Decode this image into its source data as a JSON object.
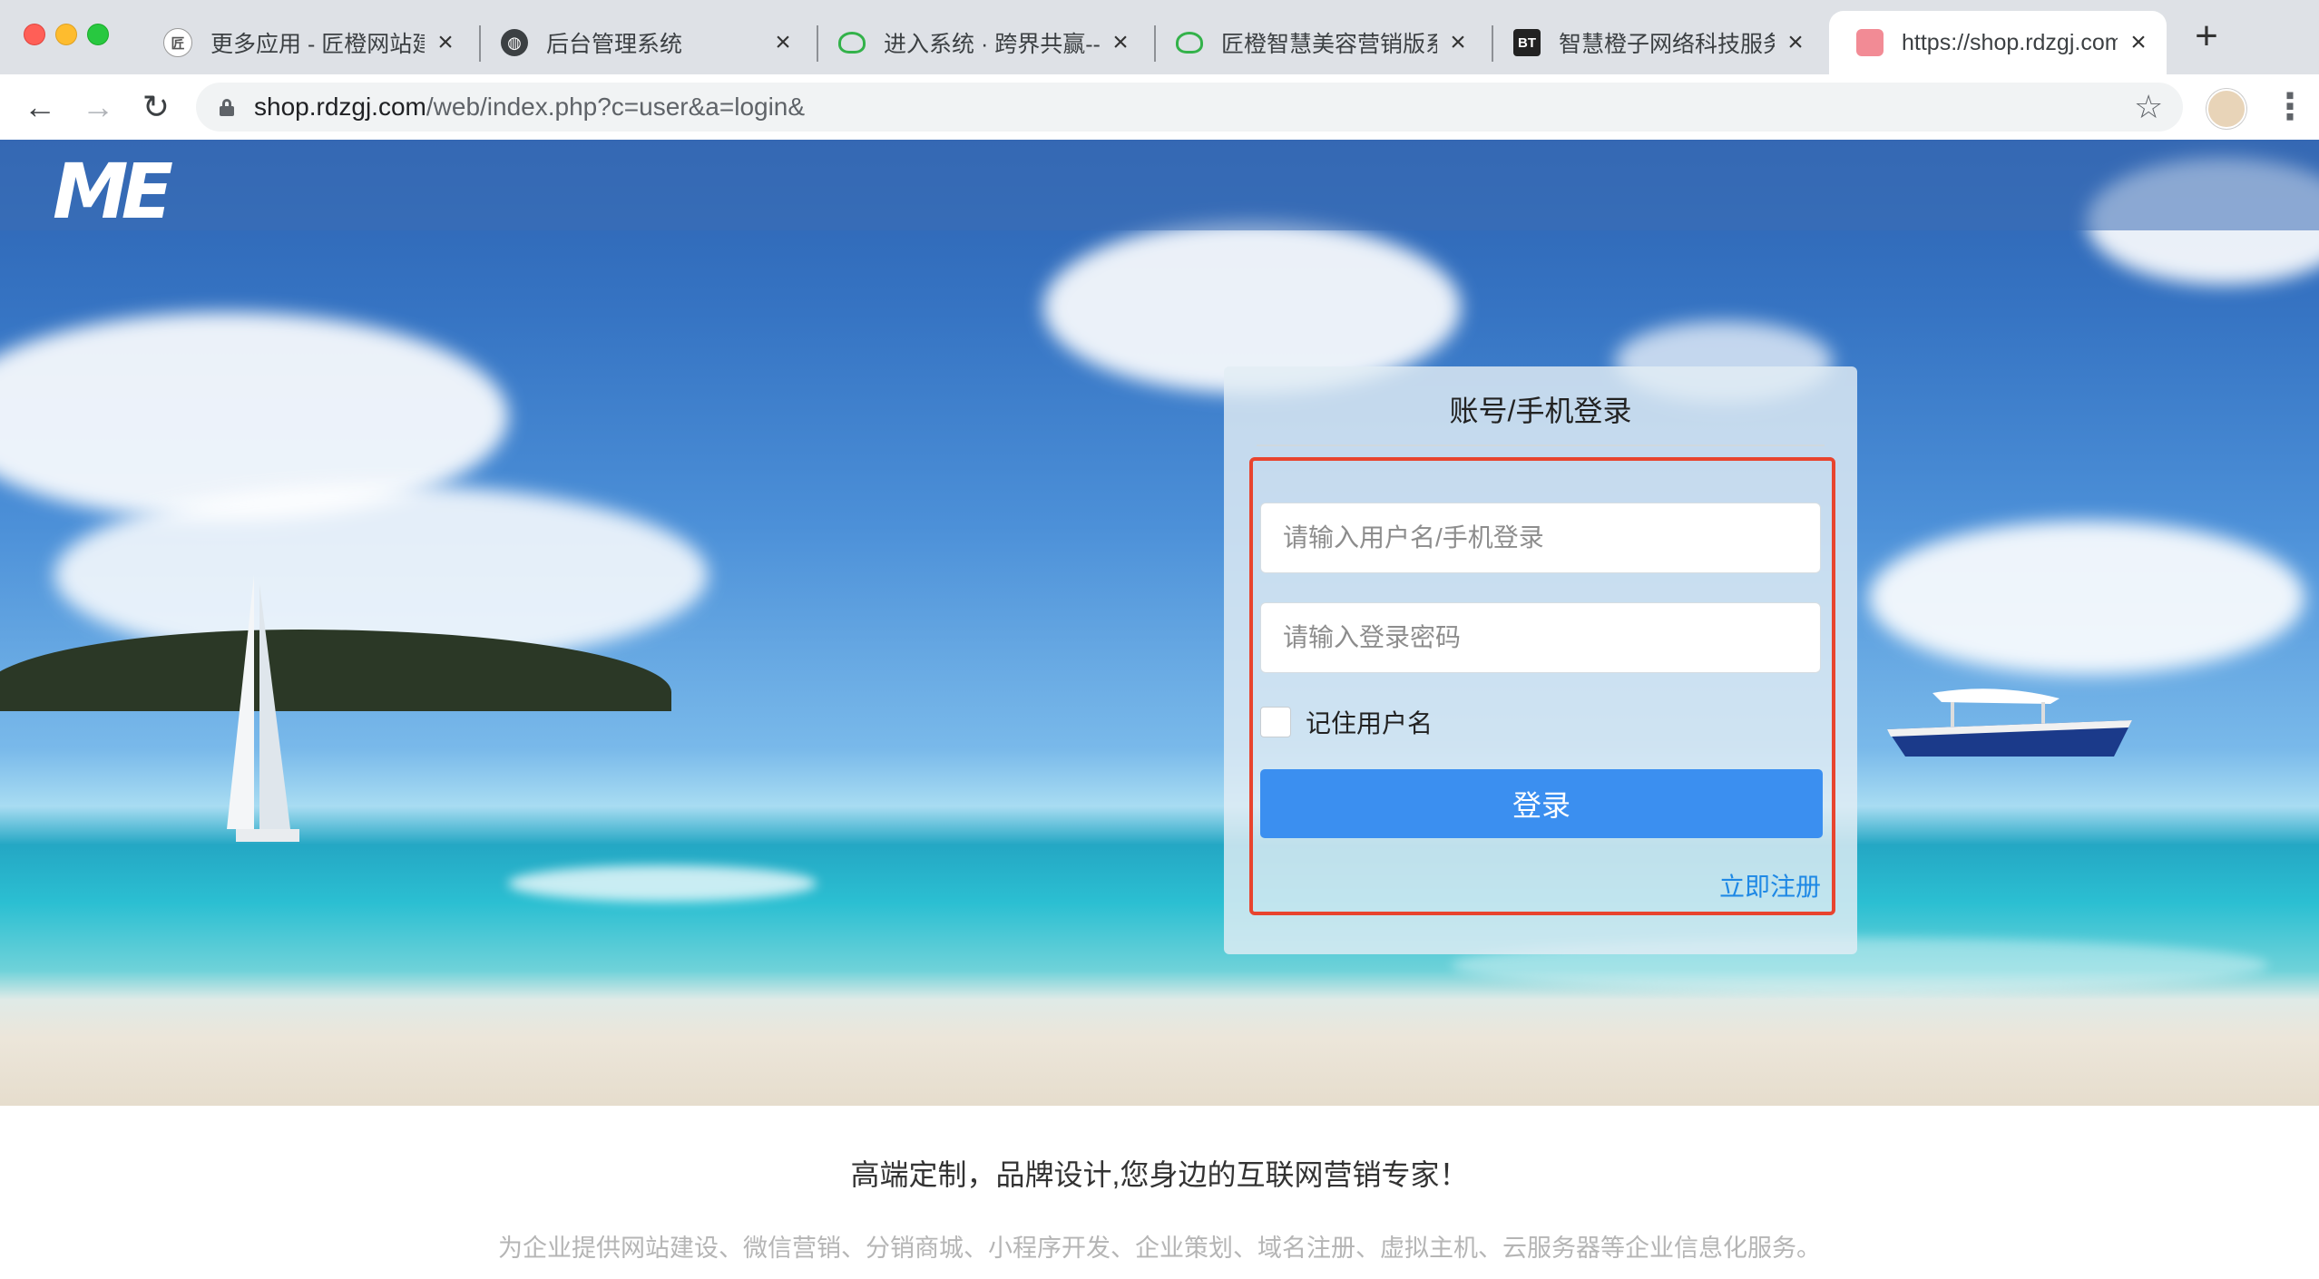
{
  "browser": {
    "tabs": [
      {
        "title": "更多应用 - 匠橙网站建",
        "icon": "site-logo-icon"
      },
      {
        "title": "后台管理系统",
        "icon": "globe-icon"
      },
      {
        "title": "进入系统 · 跨界共赢--",
        "icon": "green-cloud-icon"
      },
      {
        "title": "匠橙智慧美容营销版系",
        "icon": "green-cloud-icon"
      },
      {
        "title": "智慧橙子网络科技服务",
        "icon": "bt-icon",
        "icon_text": "BT"
      },
      {
        "title": "https://shop.rdzgj.com",
        "icon": "pink-site-icon",
        "active": true
      }
    ],
    "url_host": "shop.rdzgj.com",
    "url_path": "/web/index.php?c=user&a=login&"
  },
  "page": {
    "logo_text": "ME",
    "login": {
      "title": "账号/手机登录",
      "username_placeholder": "请输入用户名/手机登录",
      "password_placeholder": "请输入登录密码",
      "remember_label": "记住用户名",
      "submit_label": "登录",
      "register_link": "立即注册"
    },
    "footer": {
      "slogan": "高端定制，品牌设计,您身边的互联网营销专家！",
      "description": "为企业提供网站建设、微信营销、分销商城、小程序开发、企业策划、域名注册、虚拟主机、云服务器等企业信息化服务。"
    }
  },
  "colors": {
    "primary_button": "#3b8ff0",
    "link": "#1e88e5",
    "highlight_border": "#e8442e"
  }
}
